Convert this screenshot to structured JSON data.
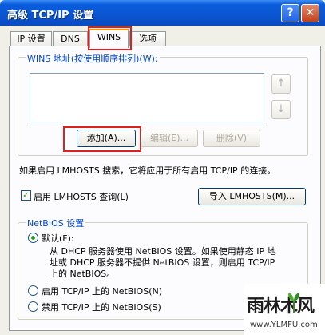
{
  "window": {
    "title": "高级 TCP/IP 设置",
    "help_glyph": "?",
    "close_glyph": "✕"
  },
  "tabs": [
    {
      "label": "IP 设置"
    },
    {
      "label": "DNS"
    },
    {
      "label": "WINS"
    },
    {
      "label": "选项"
    }
  ],
  "wins": {
    "group_title": "WINS 地址(按使用顺序排列)(W):",
    "up_glyph": "↑",
    "down_glyph": "↓",
    "add_label": "添加(A)...",
    "edit_label": "编辑(E)...",
    "remove_label": "删除(V)"
  },
  "lmhosts": {
    "info": "如果启用 LMHOSTS 搜索，它将应用于所有启用 TCP/IP 的连接。",
    "enable_label": "启用 LMHOSTS 查询(L)",
    "enable_checked": true,
    "import_label": "导入 LMHOSTS(M)..."
  },
  "netbios": {
    "group_title": "NetBIOS 设置",
    "default_label": "默认(F):",
    "default_desc": [
      "从 DHCP 服务器使用 NetBIOS 设置。如果使用静态 IP 地",
      "址或 DHCP 服务器不提供 NetBIOS 设置，则启用 TCP/IP",
      "上的 NetBIOS。"
    ],
    "enable_label": "启用 TCP/IP 上的 NetBIOS(N)",
    "disable_label": "禁用 TCP/IP 上的 NetBIOS(S)",
    "selected": "default"
  },
  "watermark": {
    "main": "雨林木风",
    "sub": "www.YLMFU.com"
  },
  "colors": {
    "highlight_box": "#e02020",
    "title_bar": "#0b55d1"
  }
}
